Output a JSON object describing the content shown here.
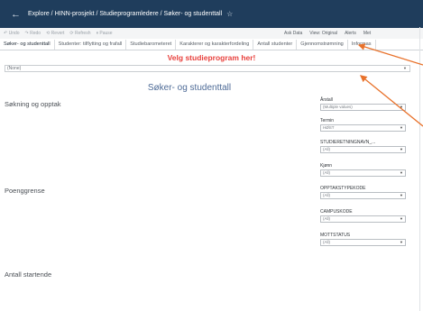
{
  "header": {
    "back_glyph": "←",
    "breadcrumb": "Explore / HINN-prosjekt / Studieprogramledere / Søker- og studenttall",
    "star_glyph": "☆"
  },
  "toolbar": {
    "left_items": [
      "↶ Undo",
      "↷ Redo",
      "⟲ Revert",
      "⟳ Refresh",
      "⏸ Pause"
    ],
    "right_items": [
      "Ask Data",
      "View: Original",
      "Alerts",
      "Met"
    ]
  },
  "tabs": [
    {
      "label": "Søker- og studenttall",
      "active": true
    },
    {
      "label": "Studenter: tilflytting og frafall",
      "active": false
    },
    {
      "label": "Studiebarometeret",
      "active": false
    },
    {
      "label": "Karakterer og karakterfordeling",
      "active": false
    },
    {
      "label": "Antall studenter",
      "active": false
    },
    {
      "label": "Gjennomstrømning",
      "active": false
    },
    {
      "label": "Informas",
      "active": false
    }
  ],
  "program_banner": "Velg studieprogram her!",
  "program_select": {
    "value": "(None)"
  },
  "main_title": "Søker- og studenttall",
  "sections": {
    "s1": "Søkning og opptak",
    "s2": "Poenggrense",
    "s3": "Antall startende"
  },
  "filters": [
    {
      "label": "Årstall",
      "value": "(Multiple values)"
    },
    {
      "label": "Termin",
      "value": "HØST"
    },
    {
      "label": "STUDIERETNINGNAVN_...",
      "value": "(All)"
    },
    {
      "label": "Kjønn",
      "value": "(All)"
    },
    {
      "label": "OPPTAKSTYPEKODE",
      "value": "(All)"
    },
    {
      "label": "CAMPUSKODE",
      "value": "(All)"
    },
    {
      "label": "MOTTSTATUS",
      "value": "(All)"
    }
  ],
  "colors": {
    "header_bg": "#1f3d5c",
    "banner_red": "#e8413d",
    "title_blue": "#4d6a96",
    "annotation_orange": "#e8712a"
  }
}
